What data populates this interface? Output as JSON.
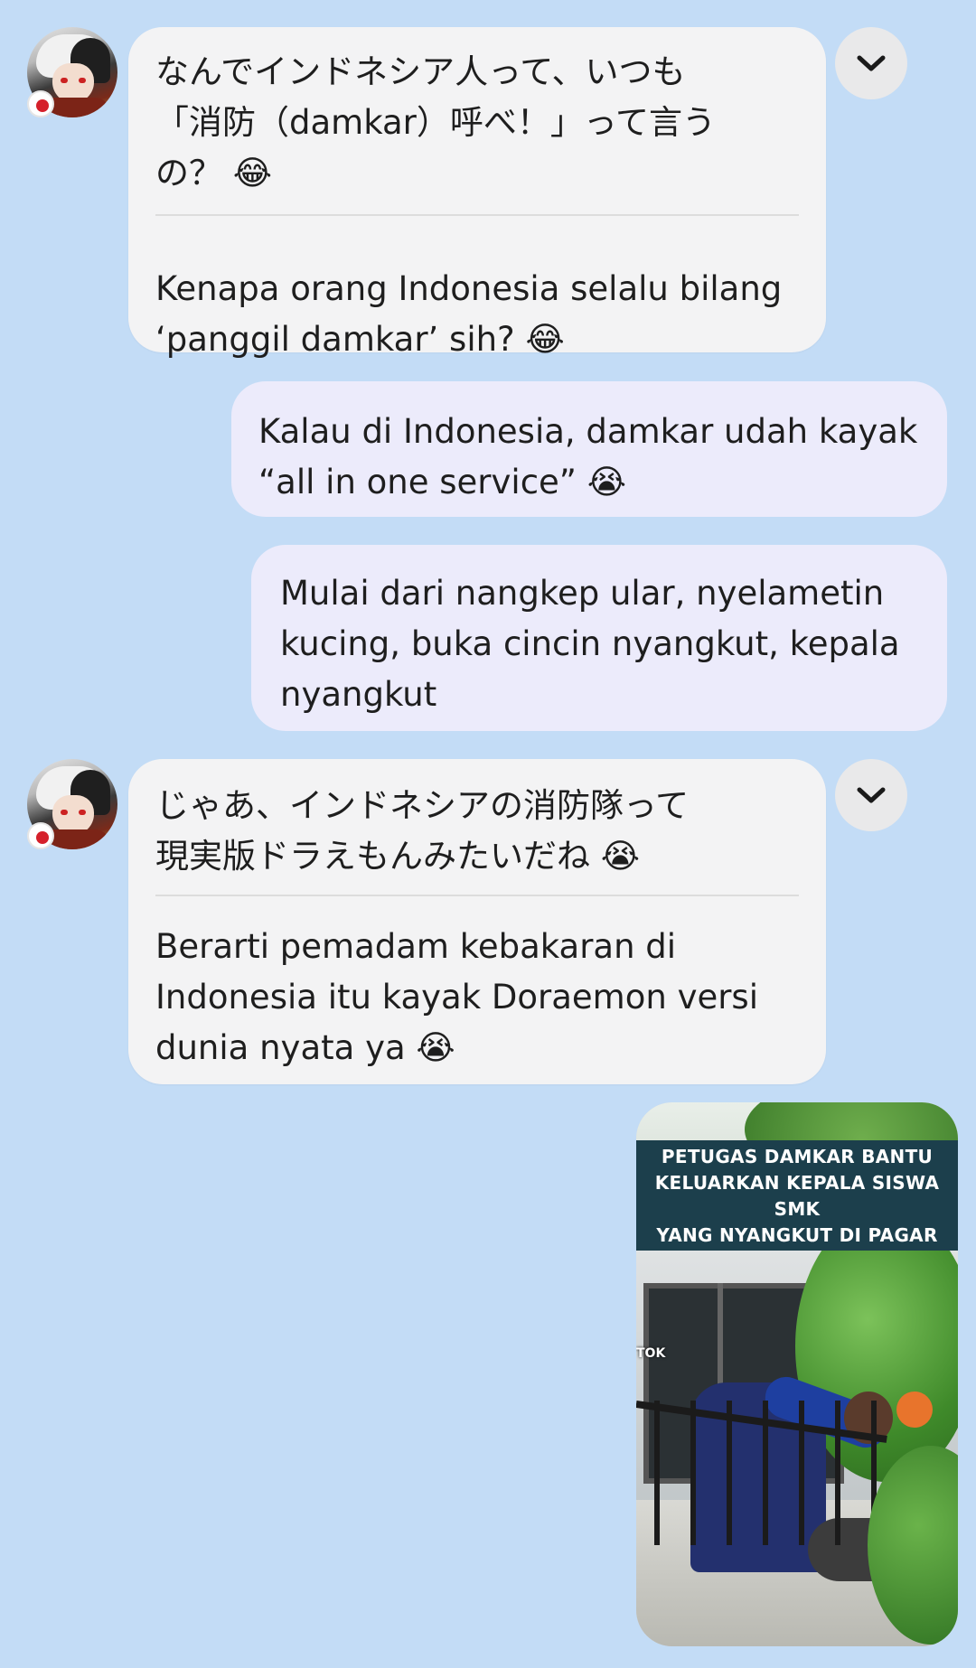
{
  "chat": {
    "messages": [
      {
        "sender": "other",
        "original": "なんでインドネシア人って、いつも\n「消防（damkar）呼べ！」って言う\nの？ 😂",
        "translation": "Kenapa orang Indonesia selalu bilang\n‘panggil damkar’ sih? 😂"
      },
      {
        "sender": "me",
        "text": "Kalau di Indonesia, damkar udah kayak\n“all in one service” 😭"
      },
      {
        "sender": "me",
        "text": "Mulai dari nangkep ular, nyelametin\nkucing, buka cincin nyangkut, kepala\nnyangkut"
      },
      {
        "sender": "other",
        "original": "じゃあ、インドネシアの消防隊って\n現実版ドラえもんみたいだね 😭",
        "translation": "Berarti pemadam kebakaran di\nIndonesia itu kayak Doraemon versi\ndunia nyata ya 😭"
      }
    ],
    "media": {
      "banner_text": "PETUGAS DAMKAR BANTU\nKELUARKAN KEPALA SISWA SMK\nYANG NYANGKUT DI PAGAR",
      "watermark": "TOK"
    }
  },
  "icons": {
    "expand": "chevron-down-icon",
    "flag": "japan-flag-icon"
  },
  "colors": {
    "background": "#c3dcf6",
    "incoming_bubble": "#f3f3f4",
    "outgoing_bubble": "#ecebfb"
  }
}
